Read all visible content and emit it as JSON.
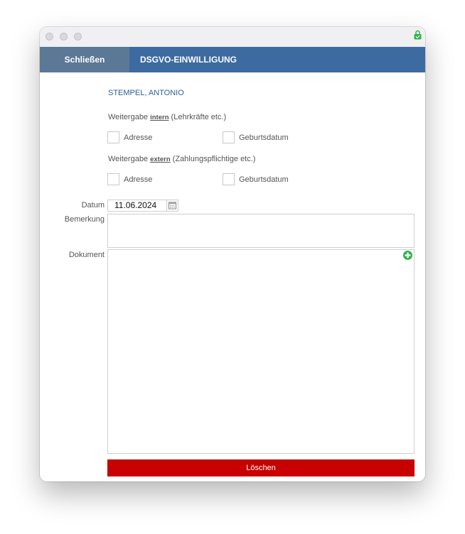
{
  "window": {
    "colors": {
      "navbar": "#3d6aa0",
      "close_button": "#5b7896",
      "delete_button": "#c80000",
      "accent_text": "#2d5f98",
      "add_icon": "#2db34a"
    },
    "icons": [
      "lock-icon",
      "calendar-icon",
      "add-icon"
    ]
  },
  "navbar": {
    "close_label": "Schließen",
    "title": "DSGVO-EINWILLIGUNG"
  },
  "person": {
    "name": "STEMPEL, ANTONIO"
  },
  "sections": [
    {
      "prefix": "Weitergabe ",
      "keyword": "intern",
      "suffix": " (Lehrkräfte etc.)",
      "options": [
        {
          "label": "Adresse",
          "checked": false
        },
        {
          "label": "Geburtsdatum",
          "checked": false
        }
      ]
    },
    {
      "prefix": "Weitergabe ",
      "keyword": "extern",
      "suffix": " (Zahlungspflichtige etc.)",
      "options": [
        {
          "label": "Adresse",
          "checked": false
        },
        {
          "label": "Geburtsdatum",
          "checked": false
        }
      ]
    }
  ],
  "form": {
    "date_label": "Datum",
    "date_value": "11.06.2024",
    "remark_label": "Bemerkung",
    "remark_value": "",
    "document_label": "Dokument"
  },
  "actions": {
    "delete_label": "Löschen"
  }
}
